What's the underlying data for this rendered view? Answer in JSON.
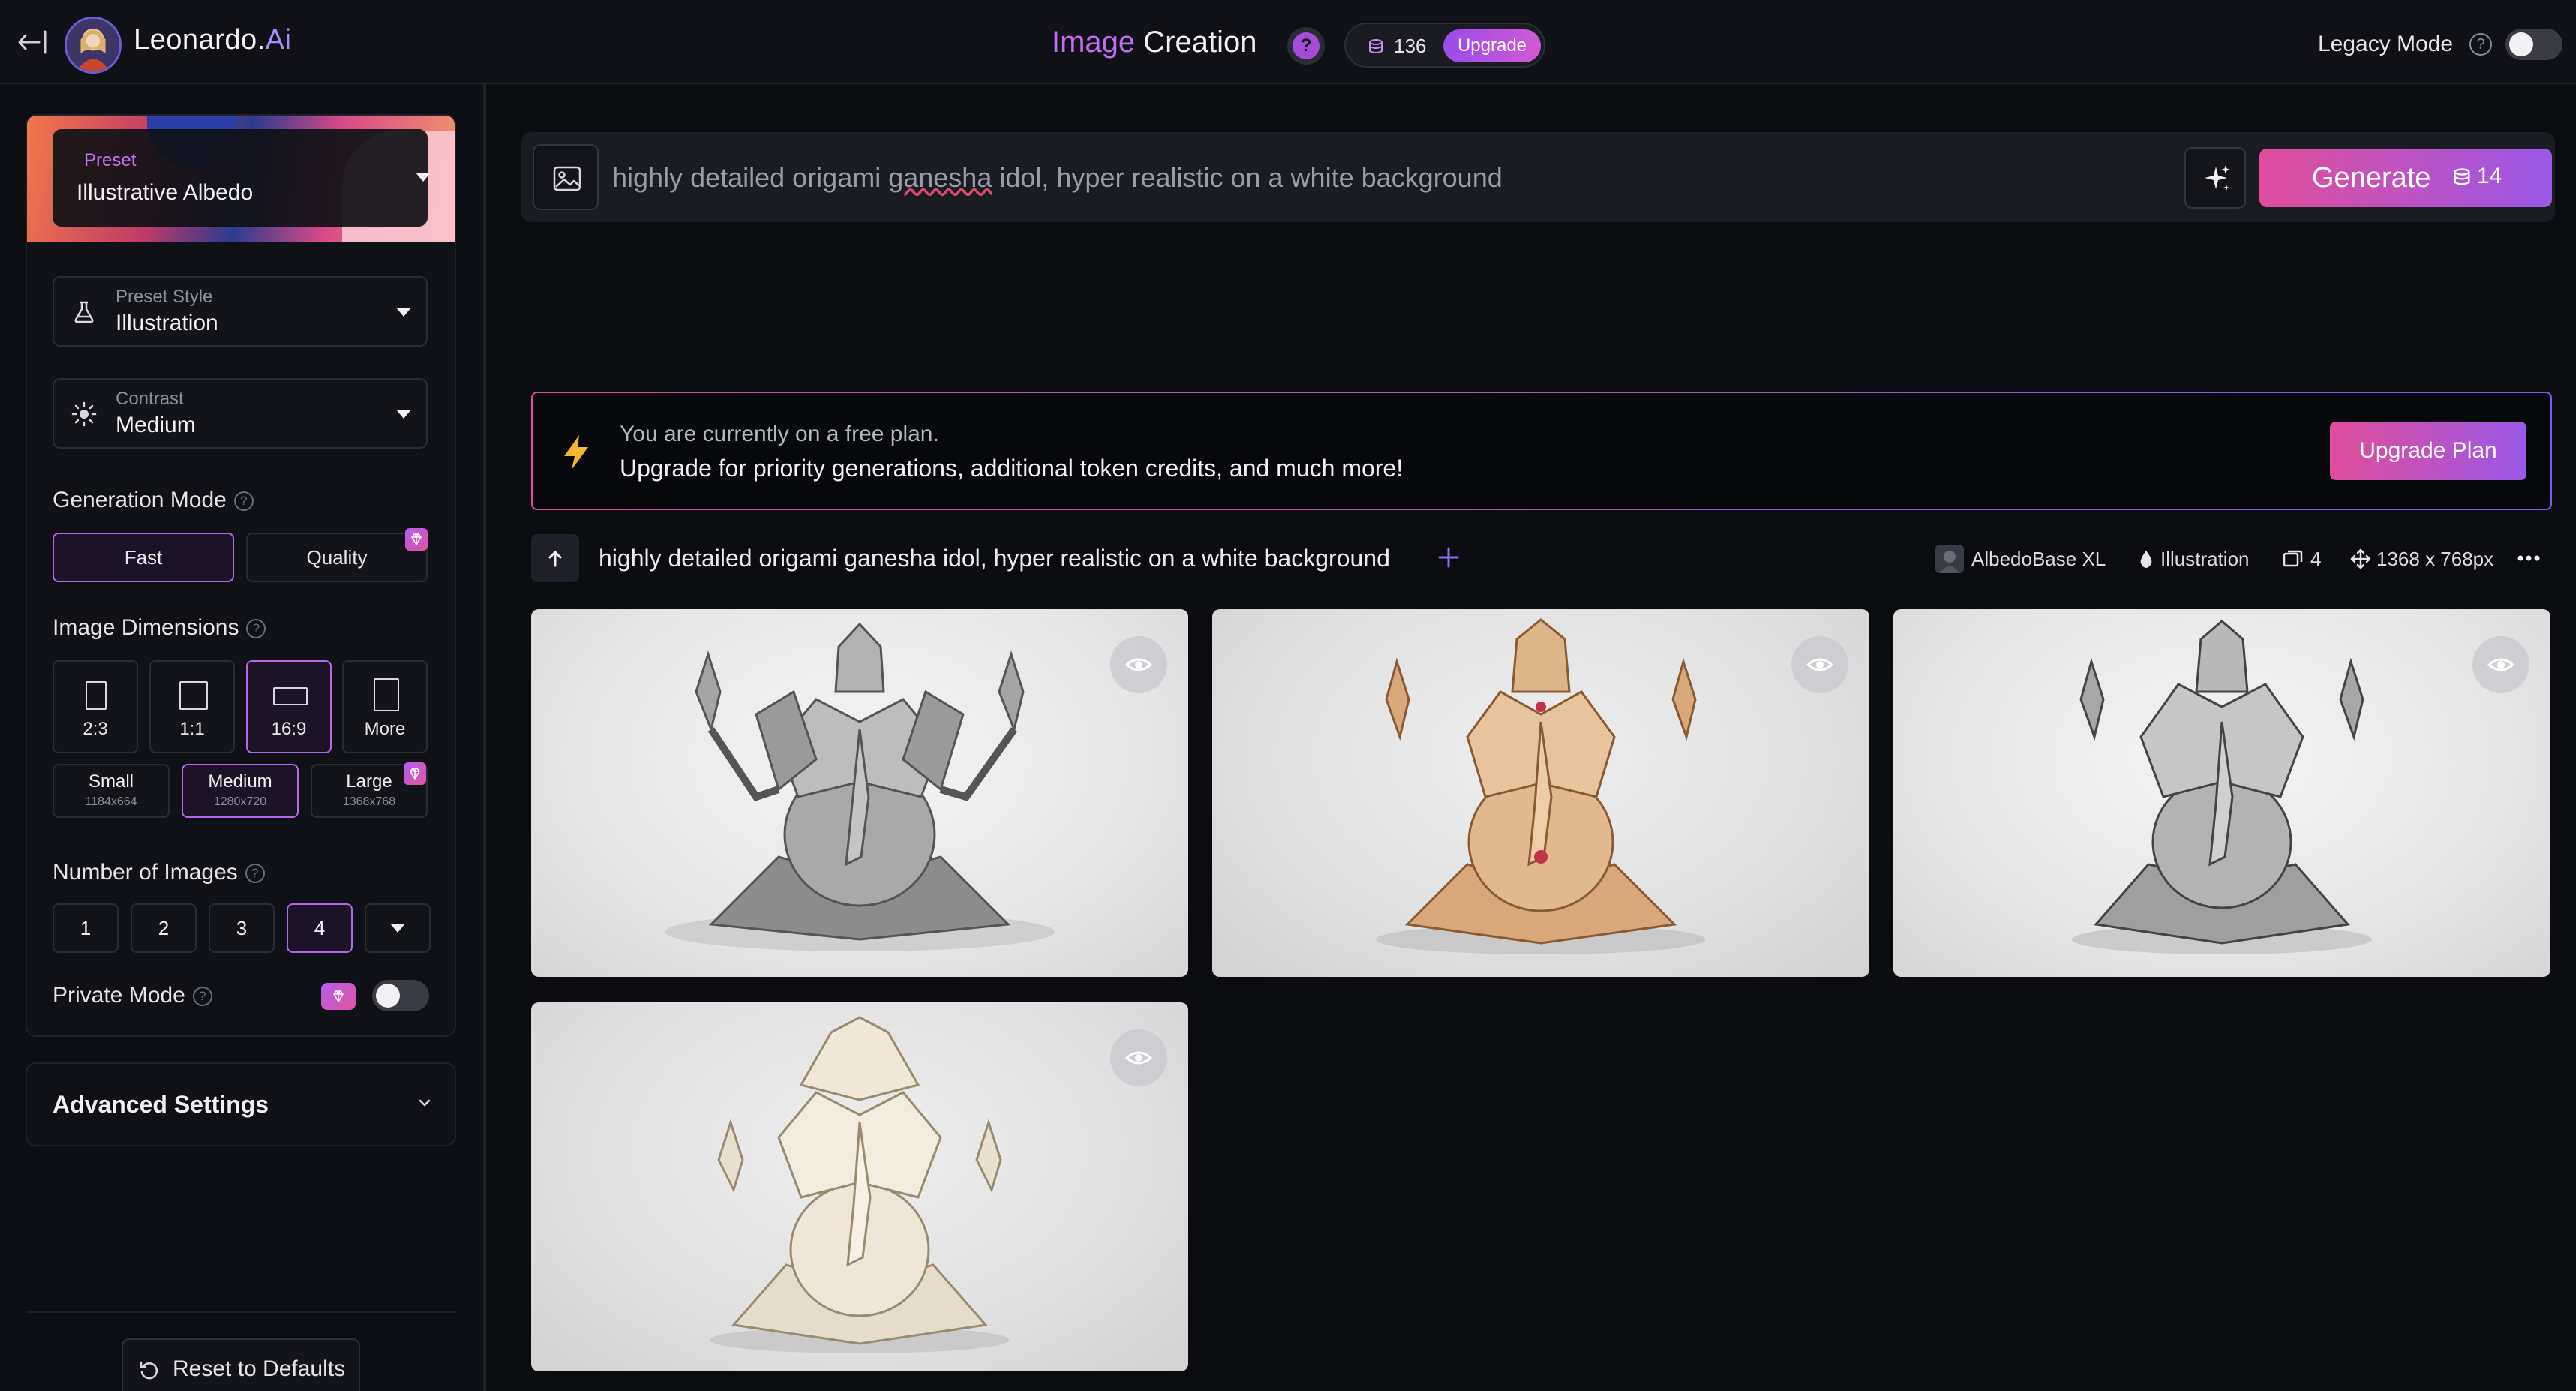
{
  "header": {
    "brand_name": "Leonardo.",
    "brand_suffix": "Ai",
    "title_part1": "Image",
    "title_part2": "Creation",
    "help": "?",
    "tokens": "136",
    "upgrade": "Upgrade",
    "legacy_mode": "Legacy Mode",
    "legacy_help": "?"
  },
  "sidebar": {
    "preset_label": "Preset",
    "preset_value": "Illustrative Albedo",
    "preset_style_label": "Preset Style",
    "preset_style_value": "Illustration",
    "contrast_label": "Contrast",
    "contrast_value": "Medium",
    "generation_mode_label": "Generation Mode",
    "mode_fast": "Fast",
    "mode_quality": "Quality",
    "image_dimensions_label": "Image Dimensions",
    "aspect": [
      "2:3",
      "1:1",
      "16:9",
      "More"
    ],
    "sizes": [
      {
        "name": "Small",
        "res": "1184x664"
      },
      {
        "name": "Medium",
        "res": "1280x720"
      },
      {
        "name": "Large",
        "res": "1368x768"
      }
    ],
    "number_of_images_label": "Number of Images",
    "numbers": [
      "1",
      "2",
      "3",
      "4"
    ],
    "private_mode_label": "Private Mode",
    "advanced_settings": "Advanced Settings",
    "reset": "Reset to Defaults"
  },
  "prompt": {
    "text_before": "highly detailed origami ",
    "text_underlined": "ganesha",
    "text_after": " idol, hyper realistic on a white background",
    "generate_label": "Generate",
    "generate_cost": "14"
  },
  "banner": {
    "line1": "You are currently on a free plan.",
    "line2": "Upgrade for priority generations, additional token credits, and much more!",
    "button": "Upgrade Plan"
  },
  "generation": {
    "prompt": "highly detailed origami ganesha idol, hyper realistic on a white background",
    "model": "AlbedoBase XL",
    "style": "Illustration",
    "count": "4",
    "dimensions": "1368 x 768px"
  },
  "colors": {
    "accent_pink": "#e04e9b",
    "accent_purple": "#9b58e8",
    "background": "#0b0c10"
  },
  "icons": [
    "back-arrow-icon",
    "image-icon",
    "sparkle-icon",
    "bolt-icon",
    "eye-icon",
    "plus-icon",
    "more-icon",
    "gem-icon",
    "refresh-icon"
  ]
}
